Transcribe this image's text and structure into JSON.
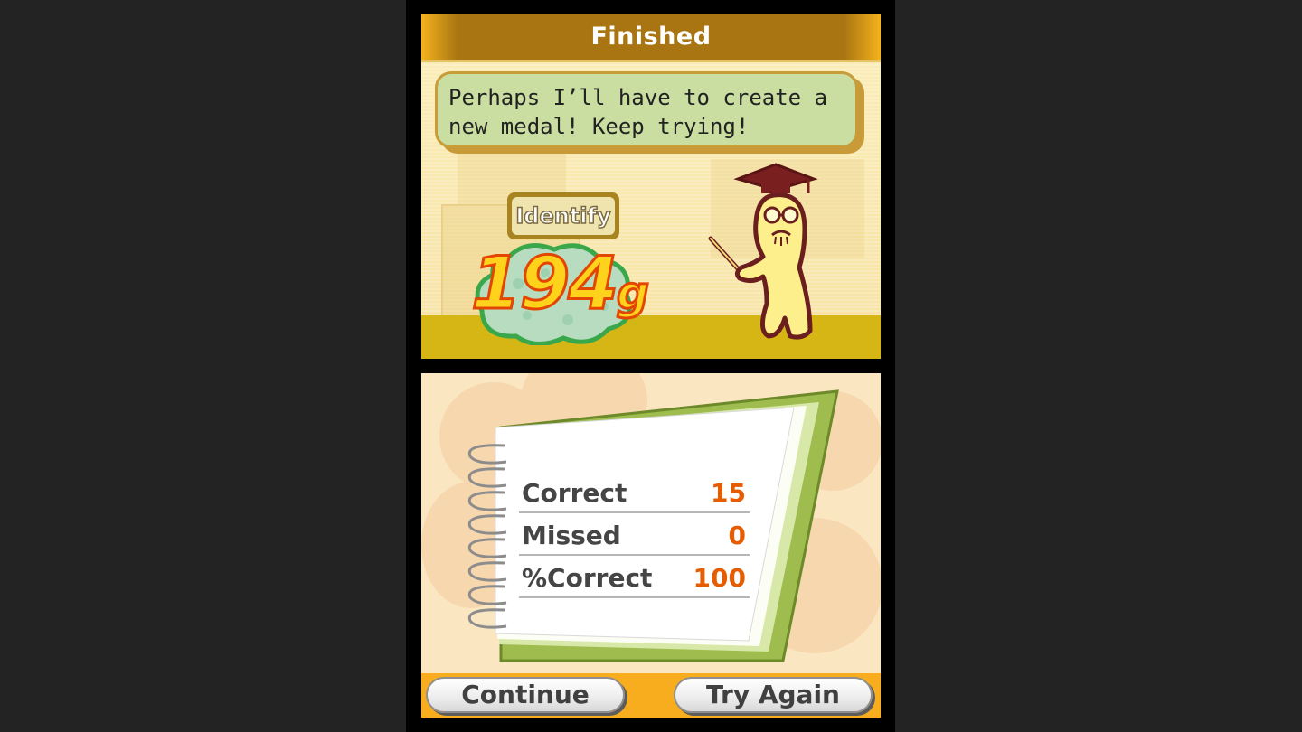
{
  "top_screen": {
    "title": "Finished",
    "message": "Perhaps I’ll have to create a new medal! Keep trying!",
    "mode_label": "Identify",
    "score_value": "194",
    "score_unit": "g"
  },
  "results": {
    "rows": [
      {
        "label": "Correct",
        "value": "15"
      },
      {
        "label": "Missed",
        "value": "0"
      },
      {
        "label": "%Correct",
        "value": "100"
      }
    ]
  },
  "buttons": {
    "continue_label": "Continue",
    "try_again_label": "Try Again"
  },
  "colors": {
    "title_bar": "#a87512",
    "speech_bubble": "#c9dea0",
    "score_fill": "#ffd31c",
    "score_outline": "#e34600",
    "stat_value": "#e65c00",
    "button_bar": "#f7ad1d",
    "notebook_cover": "#9fbc4e"
  },
  "icons": {
    "professor": "professor-character-icon",
    "notebook": "spiral-notebook-icon",
    "score_cloud": "score-cloud-icon"
  }
}
